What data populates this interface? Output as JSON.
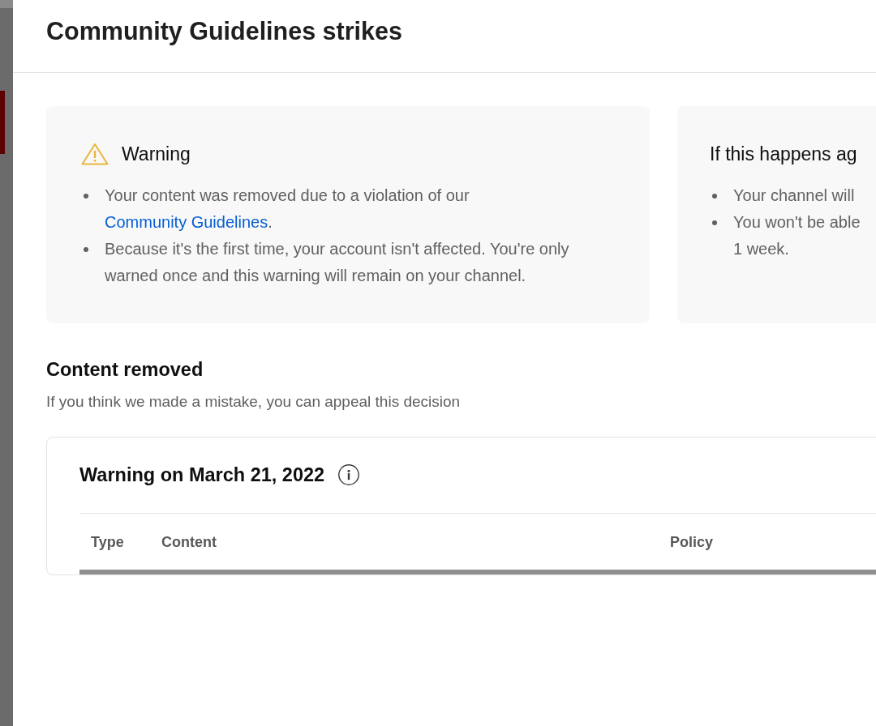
{
  "dialog": {
    "title": "Community Guidelines strikes"
  },
  "cards": [
    {
      "kind": "warning",
      "title": "Warning",
      "items": [
        {
          "text": "Your content was removed due to a violation of our ",
          "link": "Community Guidelines",
          "after": "."
        },
        {
          "text": "Because it's the first time, your account isn't affected. You're only warned once and this warning will remain on your channel."
        }
      ]
    },
    {
      "kind": "notice",
      "title": "If this happens ag",
      "items": [
        {
          "text": "Your channel will"
        },
        {
          "lines": [
            "You won't be able",
            "1 week."
          ]
        }
      ]
    }
  ],
  "content_removed": {
    "heading": "Content removed",
    "subtitle": "If you think we made a mistake, you can appeal this decision"
  },
  "strike_card": {
    "title": "Warning on March 21, 2022",
    "columns": [
      "Type",
      "Content",
      "Policy"
    ]
  }
}
